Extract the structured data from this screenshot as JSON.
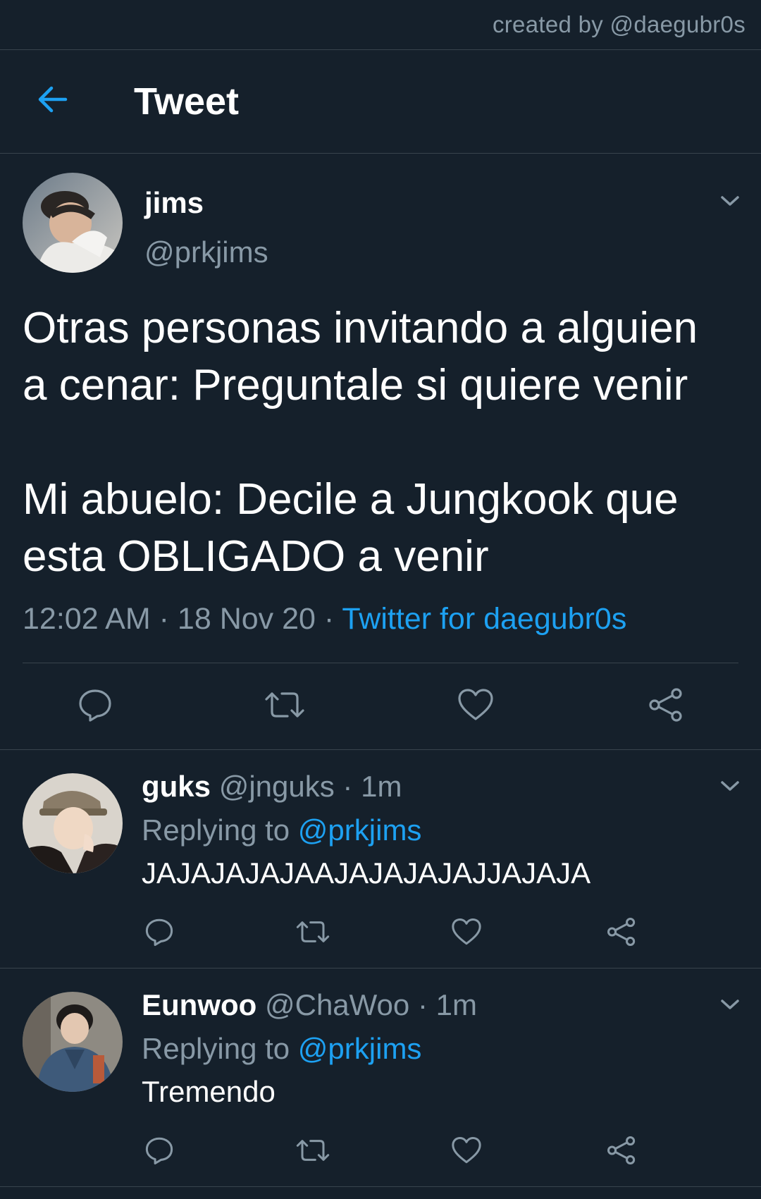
{
  "credit": "created by @daegubr0s",
  "header": {
    "title": "Tweet",
    "back_icon": "arrow-left-icon"
  },
  "colors": {
    "background": "#15202b",
    "divider": "#38444d",
    "secondary_text": "#8899a6",
    "accent": "#1da1f2"
  },
  "main_tweet": {
    "author_name": "jims",
    "author_handle": "@prkjims",
    "text_lines": [
      "Otras personas invitando a alguien",
      "a cenar: Preguntale si quiere venir",
      "Mi abuelo: Decile a Jungkook que",
      "esta OBLIGADO a venir"
    ],
    "time": "12:02 AM",
    "date": "18 Nov 20",
    "separator": "·",
    "source": "Twitter for daegubr0s",
    "actions": [
      "reply-icon",
      "retweet-icon",
      "like-icon",
      "share-icon"
    ]
  },
  "replies": [
    {
      "name": "guks",
      "handle": "@jnguks",
      "time": "1m",
      "separator": "·",
      "replying_prefix": "Replying to",
      "replying_to": "@prkjims",
      "text": "JAJAJAJAJAAJAJAJAJAJJAJAJA"
    },
    {
      "name": "Eunwoo",
      "handle": "@ChaWoo",
      "time": "1m",
      "separator": "·",
      "replying_prefix": "Replying to",
      "replying_to": "@prkjims",
      "text": "Tremendo"
    }
  ]
}
